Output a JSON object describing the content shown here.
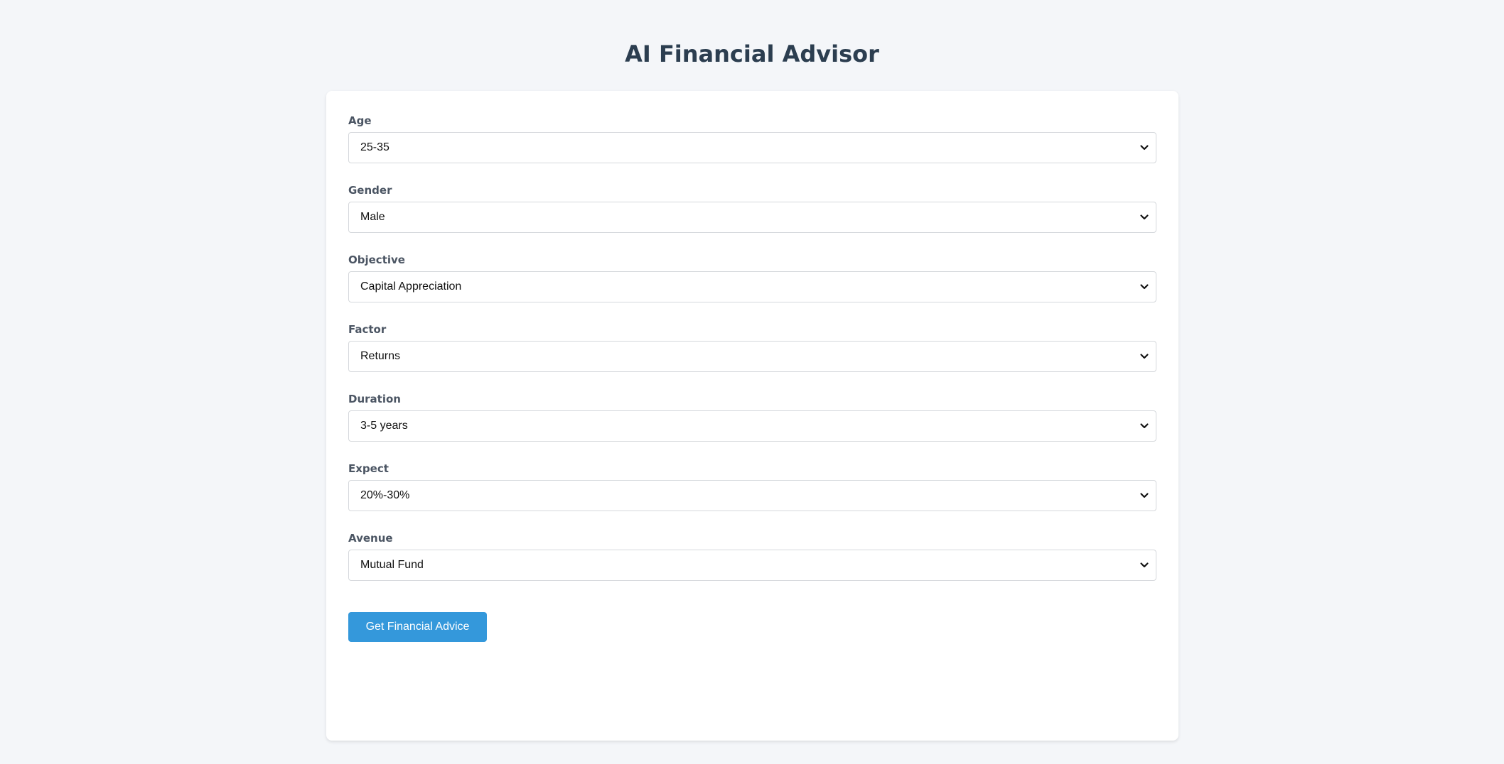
{
  "header": {
    "title": "AI Financial Advisor"
  },
  "form": {
    "fields": [
      {
        "label": "Age",
        "value": "25-35"
      },
      {
        "label": "Gender",
        "value": "Male"
      },
      {
        "label": "Objective",
        "value": "Capital Appreciation"
      },
      {
        "label": "Factor",
        "value": "Returns"
      },
      {
        "label": "Duration",
        "value": "3-5 years"
      },
      {
        "label": "Expect",
        "value": "20%-30%"
      },
      {
        "label": "Avenue",
        "value": "Mutual Fund"
      }
    ],
    "submit_label": "Get Financial Advice"
  },
  "colors": {
    "background": "#f4f6f9",
    "card": "#ffffff",
    "title": "#2c3e50",
    "label": "#4b5563",
    "button": "#3498db",
    "button_text": "#ffffff"
  },
  "icons": {
    "dropdown": "chevron-down-icon"
  }
}
